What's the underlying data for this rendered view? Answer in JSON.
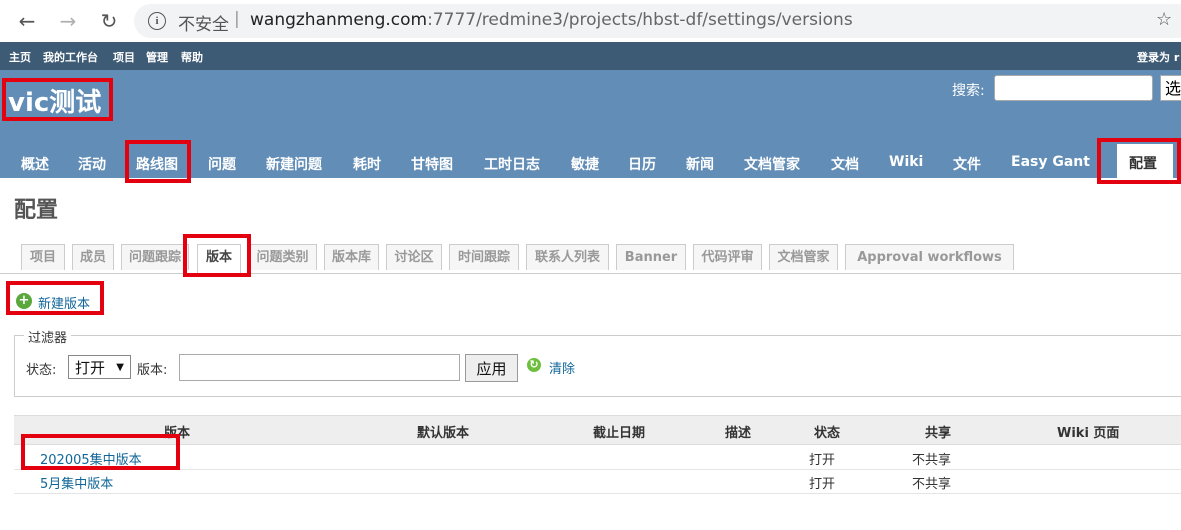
{
  "browser": {
    "back": "←",
    "forward": "→",
    "reload": "↻",
    "info": "i",
    "security": "不安全",
    "separator": "|",
    "url_host": "wangzhanmeng.com",
    "url_path": ":7777/redmine3/projects/hbst-df/settings/versions",
    "bookmark": "☆"
  },
  "top_menu": {
    "items": [
      "主页",
      "我的工作台",
      "项目",
      "管理",
      "帮助"
    ],
    "logged_as": "登录为 r"
  },
  "header": {
    "project_title": "vic测试",
    "search_label": "搜索:",
    "search_select": "选"
  },
  "main_tabs": [
    "概述",
    "活动",
    "路线图",
    "问题",
    "新建问题",
    "耗时",
    "甘特图",
    "工时日志",
    "敏捷",
    "日历",
    "新闻",
    "文档管家",
    "文档",
    "Wiki",
    "文件",
    "Easy Gant",
    "配置"
  ],
  "page_title": "配置",
  "settings_tabs": [
    "项目",
    "成员",
    "问题跟踪",
    "版本",
    "问题类别",
    "版本库",
    "讨论区",
    "时间跟踪",
    "联系人列表",
    "Banner",
    "代码评审",
    "文档管家",
    "Approval workflows"
  ],
  "new_version": {
    "icon": "+",
    "label": "新建版本"
  },
  "filter": {
    "legend": "过滤器",
    "status_label": "状态:",
    "status_value": "打开",
    "version_label": "版本:",
    "apply_label": "应用",
    "clear_label": "清除"
  },
  "table": {
    "columns": [
      "版本",
      "默认版本",
      "截止日期",
      "描述",
      "状态",
      "共享",
      "Wiki 页面"
    ],
    "rows": [
      {
        "version": "202005集中版本",
        "status": "打开",
        "sharing": "不共享"
      },
      {
        "version": "5月集中版本",
        "status": "打开",
        "sharing": "不共享"
      }
    ]
  },
  "colors": {
    "header_bg": "#628db6",
    "top_menu_bg": "#3e5b76",
    "link": "#116699",
    "annotation": "#e3000f"
  }
}
